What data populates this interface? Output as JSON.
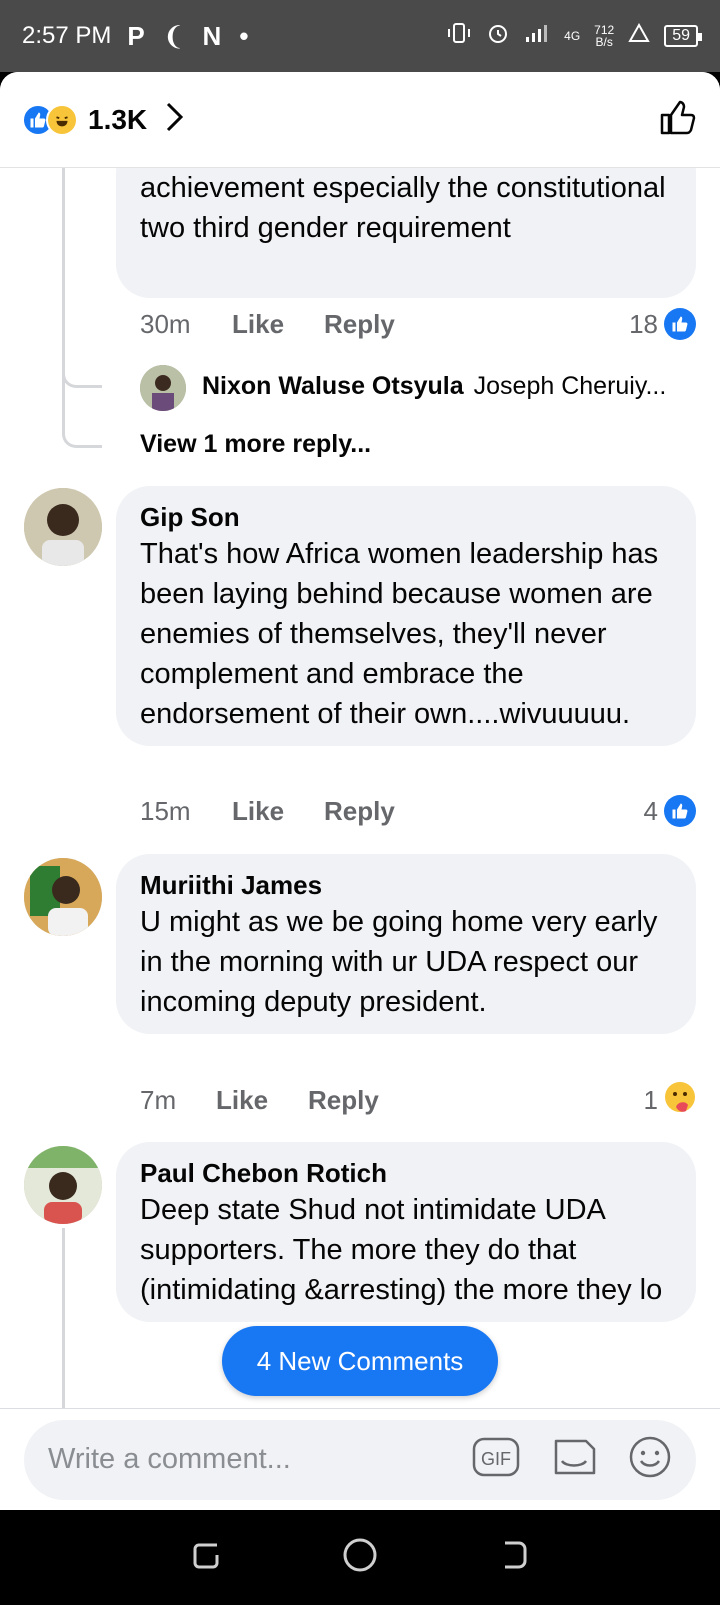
{
  "status_bar": {
    "time": "2:57 PM",
    "app_icons": [
      "P",
      "❨",
      "N",
      "•"
    ],
    "network_type": "4G",
    "net_speed_value": "712",
    "net_speed_unit": "B/s",
    "battery": "59"
  },
  "reactions": {
    "count": "1.3K",
    "types": [
      "like-icon",
      "haha-icon"
    ]
  },
  "comments": [
    {
      "text_tail": "achievement especially the constitutional two third gender requirement",
      "time": "30m",
      "like_label": "Like",
      "reply_label": "Reply",
      "reaction_count": "18",
      "reaction_type": "like-icon"
    },
    {
      "author": "Gip Son",
      "text": "That's how Africa women leadership has been laying behind because women are enemies of themselves, they'll never complement and embrace the endorsement of their own....wivuuuuu.",
      "time": "15m",
      "like_label": "Like",
      "reply_label": "Reply",
      "reaction_count": "4",
      "reaction_type": "like-icon"
    },
    {
      "author": "Muriithi James",
      "text": "U might as we be going home very early in the morning with ur UDA respect our incoming deputy president.",
      "time": "7m",
      "like_label": "Like",
      "reply_label": "Reply",
      "reaction_count": "1",
      "reaction_type": "care-icon"
    },
    {
      "author": "Paul Chebon Rotich",
      "text": "Deep state Shud not intimidate UDA supporters. The more they do that (intimidating &arresting) the more they lo"
    }
  ],
  "reply_preview": {
    "author": "Nixon Waluse Otsyula",
    "text": "Joseph Cheruiy..."
  },
  "view_more_replies": "View 1 more reply...",
  "new_comments_label": "4 New Comments",
  "composer": {
    "placeholder": "Write a comment...",
    "gif_label": "GIF"
  },
  "colors": {
    "accent": "#1877f2",
    "bubble": "#f0f2f5",
    "secondary_text": "#65676b"
  }
}
